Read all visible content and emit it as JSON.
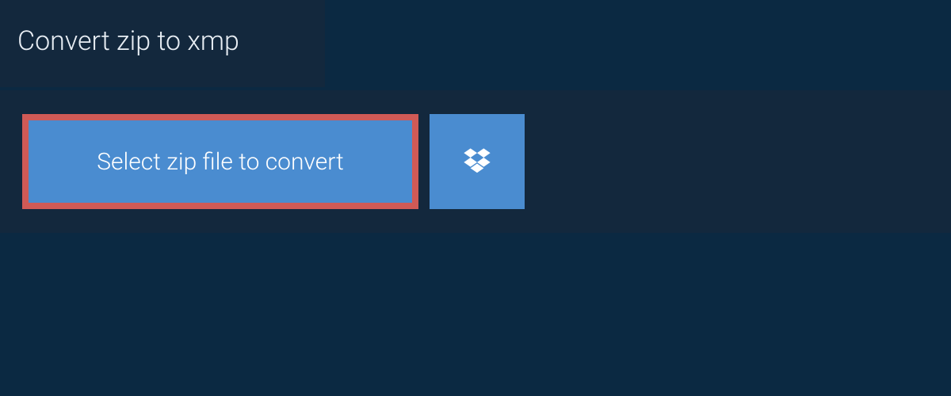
{
  "header": {
    "title": "Convert zip to xmp"
  },
  "actions": {
    "select_file_label": "Select zip file to convert"
  },
  "colors": {
    "page_bg": "#0b2942",
    "panel_bg": "#13283d",
    "button_bg": "#4a8cd0",
    "highlight_border": "#d05a56",
    "text_light": "#ffffff"
  }
}
